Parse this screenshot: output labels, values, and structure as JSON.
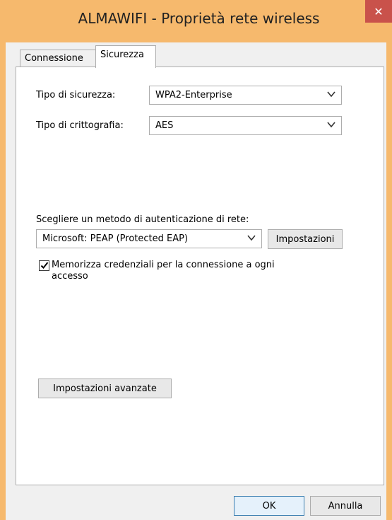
{
  "window": {
    "title": "ALMAWIFI - Proprietà rete wireless",
    "close_glyph": "✕"
  },
  "tabs": [
    {
      "label": "Connessione",
      "active": false
    },
    {
      "label": "Sicurezza",
      "active": true
    }
  ],
  "security": {
    "type_label": "Tipo di sicurezza:",
    "type_value": "WPA2-Enterprise",
    "encryption_label": "Tipo di crittografia:",
    "encryption_value": "AES"
  },
  "auth": {
    "label": "Scegliere un metodo di autenticazione di rete:",
    "method_value": "Microsoft: PEAP (Protected EAP)",
    "settings_button": "Impostazioni",
    "remember_checked": true,
    "remember_line1": "Memorizza credenziali per la connessione a ogni",
    "remember_line2": "accesso"
  },
  "advanced_button": "Impostazioni avanzate",
  "footer": {
    "ok": "OK",
    "cancel": "Annulla"
  },
  "colors": {
    "titlebar": "#f6b96d",
    "close": "#c9524b"
  }
}
